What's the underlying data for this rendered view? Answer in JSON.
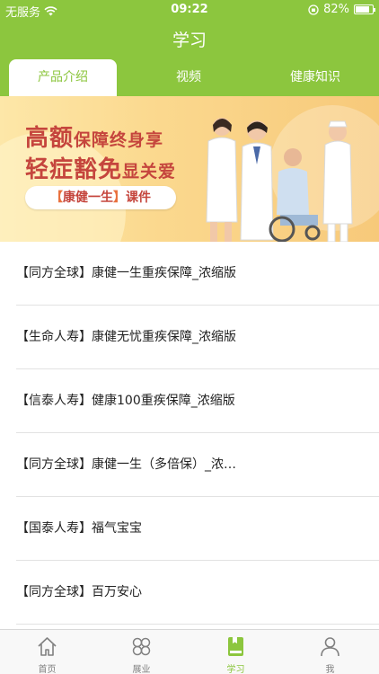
{
  "status_bar": {
    "carrier": "无服务",
    "time": "09:22",
    "battery_percent": "82%",
    "battery_level": 0.82
  },
  "nav": {
    "title": "学习"
  },
  "tabs": [
    {
      "label": "产品介绍",
      "active": true
    },
    {
      "label": "视频",
      "active": false
    },
    {
      "label": "健康知识",
      "active": false
    }
  ],
  "banner": {
    "line1_big": "高额",
    "line1_small": "保障终身享",
    "line2_big": "轻症豁免",
    "line2_small": "显关爱",
    "pill_left_bracket": "【",
    "pill_name": "康健一生",
    "pill_right_bracket": "】",
    "pill_suffix": "课件"
  },
  "courses": [
    {
      "title": "【同方全球】康健一生重疾保障_浓缩版"
    },
    {
      "title": "【生命人寿】康健无忧重疾保障_浓缩版"
    },
    {
      "title": "【信泰人寿】健康100重疾保障_浓缩版"
    },
    {
      "title": "【同方全球】康健一生（多倍保）_浓…"
    },
    {
      "title": "【国泰人寿】福气宝宝"
    },
    {
      "title": "【同方全球】百万安心"
    }
  ],
  "tabbar": [
    {
      "label": "首页",
      "icon": "home-icon",
      "active": false
    },
    {
      "label": "展业",
      "icon": "clover-icon",
      "active": false
    },
    {
      "label": "学习",
      "icon": "book-icon",
      "active": true
    },
    {
      "label": "我",
      "icon": "person-icon",
      "active": false
    }
  ],
  "colors": {
    "accent": "#8cc63e",
    "banner_text": "#c5453d",
    "inactive": "#808080"
  }
}
